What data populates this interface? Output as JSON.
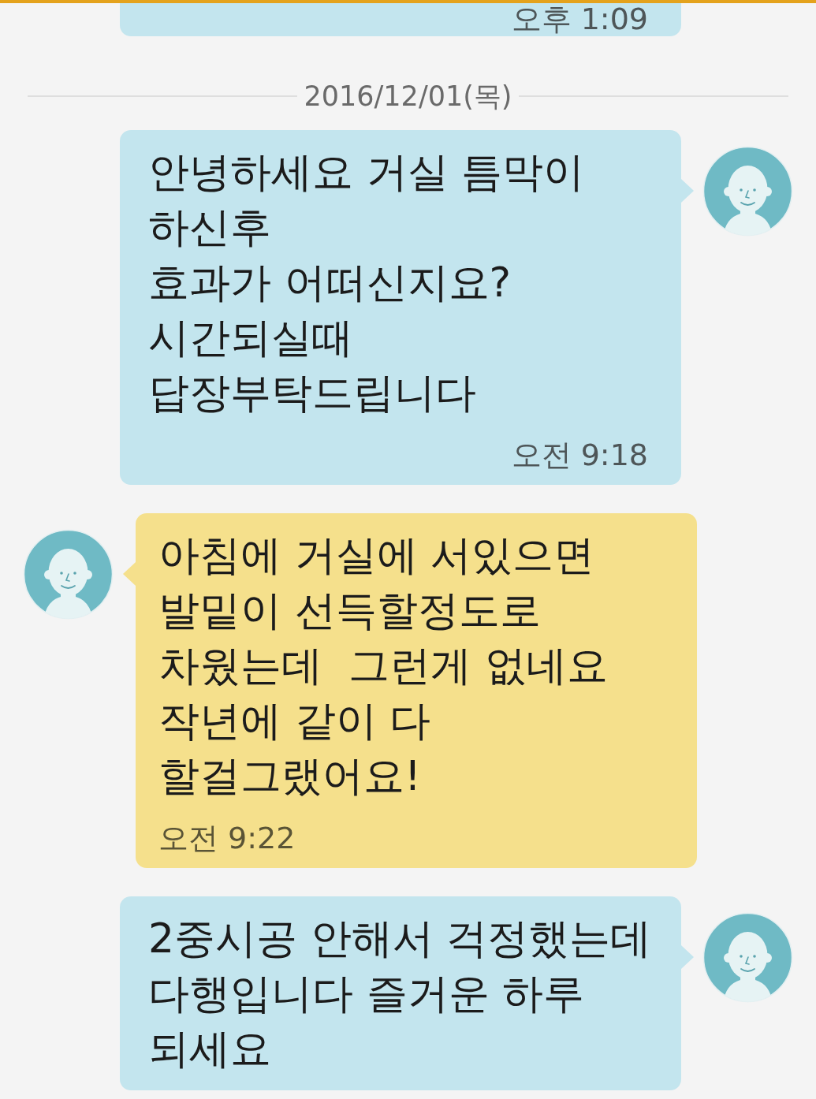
{
  "chat": [
    {
      "kind": "outgoing",
      "avatar": false,
      "time": "오후 1:09"
    },
    {
      "kind": "date",
      "text": "2016/12/01(목)"
    },
    {
      "kind": "outgoing",
      "avatar": true,
      "text": "안녕하세요 거실 틈막이\n하신후\n효과가 어떠신지요?\n시간되실때\n답장부탁드립니다",
      "time": "오전 9:18"
    },
    {
      "kind": "incoming",
      "avatar": true,
      "text": "아침에 거실에 서있으면\n발밑이 선득할정도로\n차웠는데  그런게 없네요\n작년에 같이 다\n할걸그랬어요!",
      "time": "오전 9:22"
    },
    {
      "kind": "outgoing",
      "avatar": true,
      "text": "2중시공 안해서 걱정했는데\n다행입니다 즐거운 하루\n되세요"
    }
  ]
}
